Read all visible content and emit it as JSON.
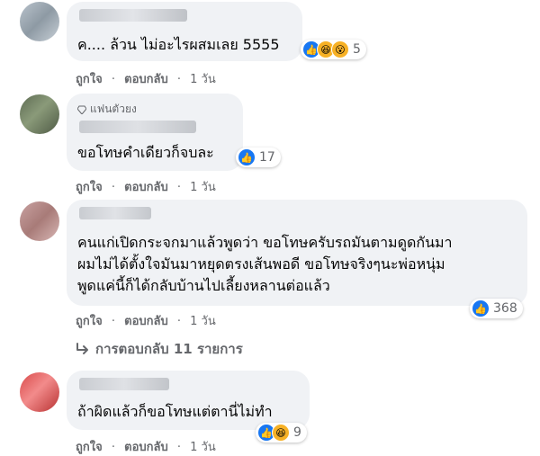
{
  "actions": {
    "like": "ถูกใจ",
    "reply": "ตอบกลับ",
    "dot": "·"
  },
  "comments": [
    {
      "text": "ค.... ล้วน ไม่อะไรผสมเลย 5555",
      "reactions_count": "5",
      "time": "1 วัน"
    },
    {
      "badge": "แฟนตัวยง",
      "text": "ขอโทษคำเดียวก็จบละ",
      "reactions_count": "17",
      "time": "1 วัน"
    },
    {
      "lines": [
        "คนแก่เปิดกระจกมาแล้วพูดว่า ขอโทษครับรถมันตามดูดกันมา",
        "ผมไม่ได้ตั้งใจมันมาหยุดตรงเส้นพอดี ขอโทษจริงๆนะพ่อหนุ่ม",
        "พูดแค่นี้ก็ได้กลับบ้านไปเลี้ยงหลานต่อแล้ว"
      ],
      "reactions_count": "368",
      "time": "1 วัน"
    },
    {
      "text": "ถ้าผิดแล้วก็ขอโทษแต่ตานี่ไม่ทำ",
      "reactions_count": "9",
      "time": "1 วัน"
    }
  ],
  "replies_link": "การตอบกลับ 11 รายการ",
  "colors": {
    "bubble": "#f0f2f5",
    "like_blue": "#1877f2",
    "haha_yellow": "#f7b125",
    "meta_gray": "#65676b"
  }
}
